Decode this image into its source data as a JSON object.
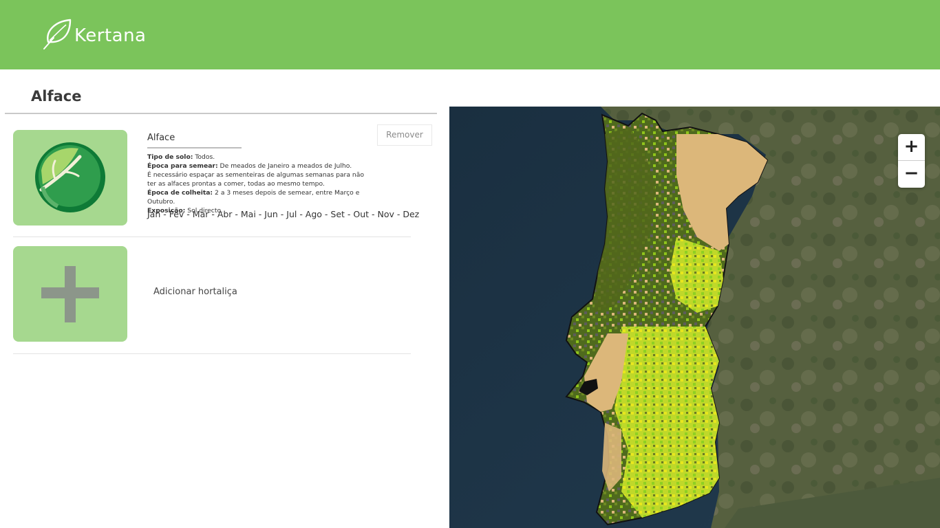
{
  "header": {
    "brand": "Kertana",
    "logo_icon": "leaf-icon",
    "background_color": "#7bc45b"
  },
  "page": {
    "title": "Alface"
  },
  "crops": [
    {
      "name": "Alface",
      "icon": "lettuce-icon",
      "remove_label": "Remover",
      "soil_label": "Tipo de solo:",
      "soil_value": "Todos.",
      "sowing_label": "Época para semear:",
      "sowing_value": "De meados de Janeiro a meados de Julho.",
      "sowing_note_1": "É necessário espaçar as sementeiras de algumas semanas para não",
      "sowing_note_2": "ter as alfaces prontas a comer, todas ao mesmo tempo.",
      "harvest_label": "Época de colheita:",
      "harvest_value": "2 a 3 meses depois de semear, entre Março e Outubro.",
      "exposure_label": "Exposição:",
      "exposure_value": "Sol directo.",
      "months": "Jan - Fev - Mar - Abr - Mai - Jun - Jul - Ago - Set - Out - Nov - Dez"
    }
  ],
  "add_crop": {
    "label": "Adicionar hortaliça",
    "icon": "plus-icon"
  },
  "map": {
    "zoom_in_label": "+",
    "zoom_out_label": "−",
    "colors": {
      "sea": "#1d3346",
      "land": "#4f5a3c",
      "suitable_yellow": "#e5e31d",
      "suitable_green": "#8fd021",
      "dark_green": "#4f6a1d",
      "soil_tan": "#dcb77a"
    }
  }
}
